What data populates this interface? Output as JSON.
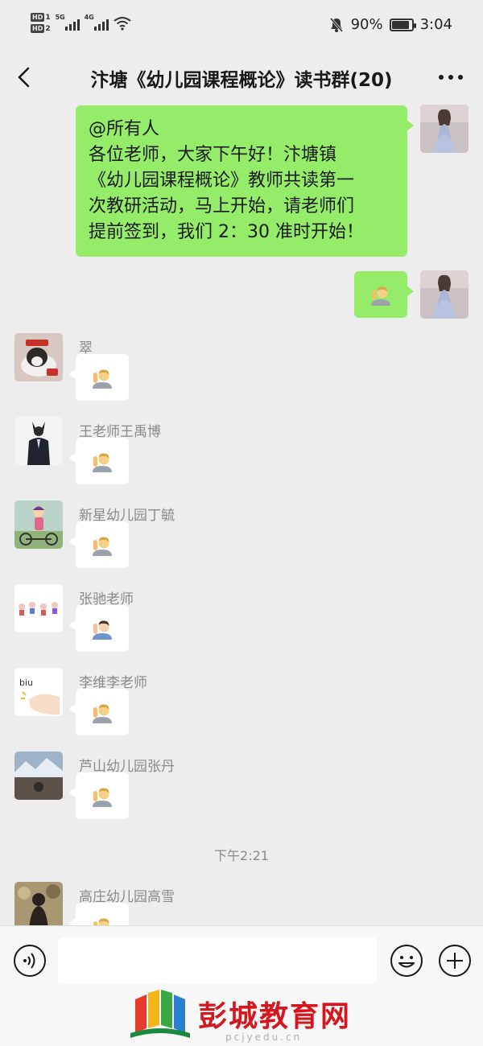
{
  "status_bar": {
    "sim1": "HD",
    "sim1_index": "1",
    "sim2": "HD",
    "sim2_index": "2",
    "net1": "5G",
    "net2": "4G",
    "battery_percent": "90%",
    "battery_level": 0.9,
    "time": "3:04",
    "icons": [
      "signal-icon",
      "wifi-icon",
      "mute-icon",
      "battery-icon"
    ]
  },
  "header": {
    "title": "汴塘《幼儿园课程概论》读书群(20)",
    "back_icon": "chevron-left-icon",
    "more_icon": "ellipsis-icon"
  },
  "messages": {
    "own_text": "@所有人\n各位老师，大家下午好！汴塘镇\n《幼儿园课程概论》教师共读第一\n次教研活动，马上开始，请老师们\n提前签到，我们 2：30 准时开始！",
    "own_emoji": "raising-hand-emoji",
    "senders": [
      "翠",
      "王老师王禹博",
      "新星幼儿园丁毓",
      "张驰老师",
      "李维李老师",
      "芦山幼儿园张丹",
      "高庄幼儿园高雪"
    ],
    "timestamp": "下午2:21"
  },
  "input_bar": {
    "placeholder": "",
    "value": "",
    "voice_icon": "voice-icon",
    "emoji_icon": "smiley-icon",
    "plus_icon": "plus-circle-icon"
  },
  "watermark": {
    "text": "彭城教育网",
    "sub": "pcjyedu.cn"
  },
  "colors": {
    "own_bubble": "#95ec69",
    "other_bubble": "#ffffff",
    "background": "#ededed",
    "watermark_red": "#d4171f"
  }
}
